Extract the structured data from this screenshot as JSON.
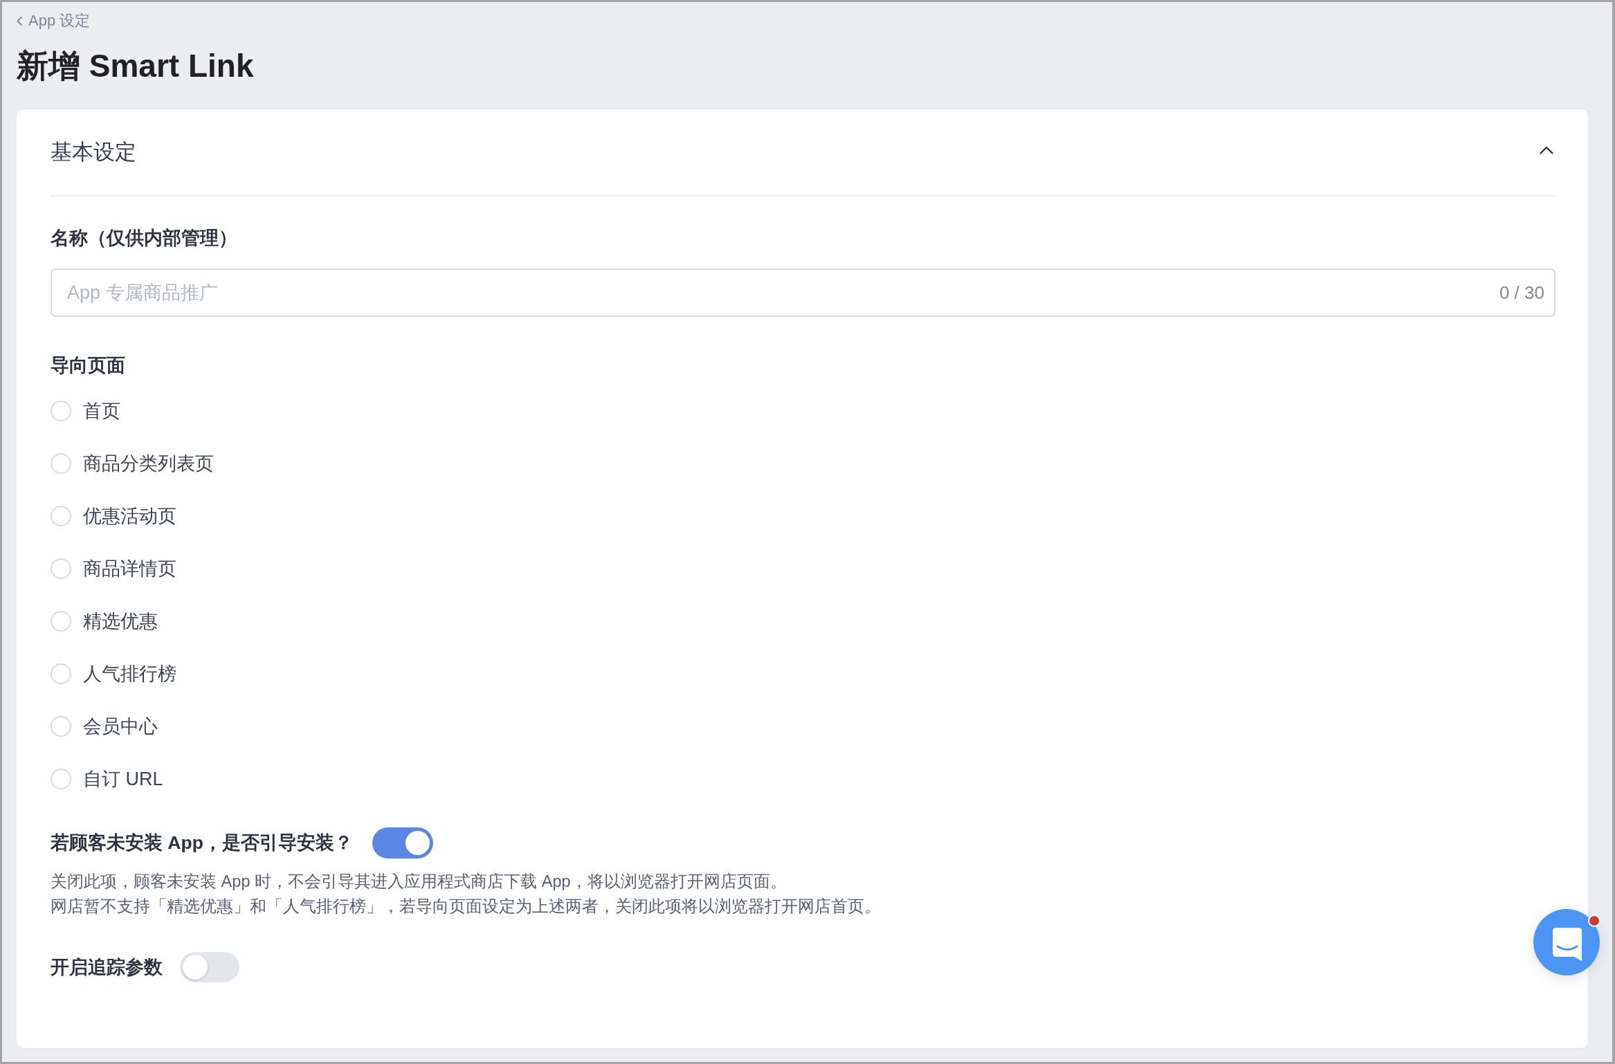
{
  "breadcrumb": {
    "back_link": "App 设定"
  },
  "page_title": "新增 Smart Link",
  "section": {
    "title": "基本设定",
    "expanded": true,
    "name_field": {
      "label": "名称（仅供内部管理）",
      "placeholder": "App 专属商品推广",
      "counter": "0 / 30"
    },
    "destination": {
      "label": "导向页面",
      "options": [
        {
          "label": "首页",
          "selected": false
        },
        {
          "label": "商品分类列表页",
          "selected": false
        },
        {
          "label": "优惠活动页",
          "selected": false
        },
        {
          "label": "商品详情页",
          "selected": false
        },
        {
          "label": "精选优惠",
          "selected": false
        },
        {
          "label": "人气排行榜",
          "selected": false
        },
        {
          "label": "会员中心",
          "selected": false
        },
        {
          "label": "自订 URL",
          "selected": false
        }
      ]
    },
    "install_prompt": {
      "label": "若顾客未安装 App，是否引导安装？",
      "on": true,
      "help": [
        "关闭此项，顾客未安装 App 时，不会引导其进入应用程式商店下载 App，将以浏览器打开网店页面。",
        "网店暂不支持「精选优惠」和「人气排行榜」，若导向页面设定为上述两者，关闭此项将以浏览器打开网店首页。"
      ]
    },
    "tracking": {
      "label": "开启追踪参数",
      "on": false
    }
  },
  "chat_widget": {
    "unread": true
  }
}
